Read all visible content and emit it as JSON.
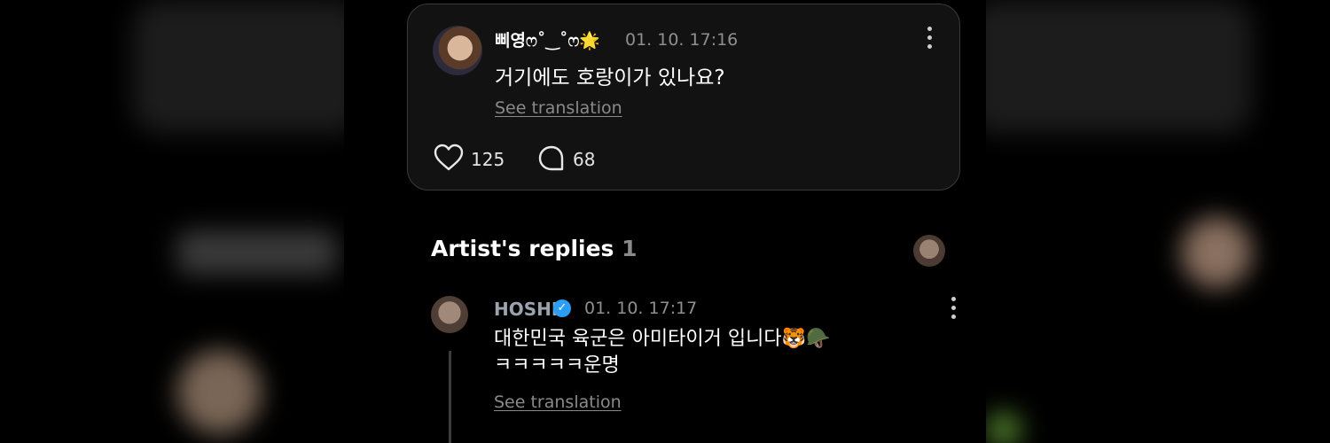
{
  "post": {
    "user_name": "삐영ෆ˚‿˚ෆ🌟",
    "time": "01. 10. 17:16",
    "text": "거기에도 호랑이가 있나요?",
    "see_translation": "See translation",
    "likes": "125",
    "comments": "68"
  },
  "replies_section": {
    "title": "Artist's replies",
    "count": "1"
  },
  "reply": {
    "user_name": "HOSHI",
    "verified_mark": "✓",
    "time": "01. 10. 17:17",
    "line1": "대한민국 육군은 아미타이거 입니다🐯🪖",
    "line2": "ㅋㅋㅋㅋㅋ운명",
    "see_translation": "See translation"
  },
  "icons": {
    "like": "heart-icon",
    "comment": "comment-bubble-icon",
    "more": "more-vertical-icon",
    "verified": "verified-badge-icon"
  },
  "colors": {
    "background": "#000000",
    "card": "#121212",
    "muted": "#8f8f8f",
    "verified": "#2a9df4"
  }
}
